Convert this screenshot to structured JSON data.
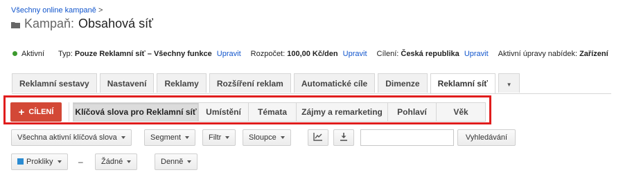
{
  "breadcrumb": {
    "link": "Všechny online kampaně",
    "separator": ">"
  },
  "title": {
    "prefix": "Kampaň:",
    "name": "Obsahová síť",
    "icon": "folder-icon"
  },
  "info": {
    "status": "Aktivní",
    "status_color": "#3c9a2e",
    "type_label": "Typ:",
    "type_value": "Pouze Reklamní síť – Všechny funkce",
    "budget_label": "Rozpočet:",
    "budget_value": "100,00 Kč/den",
    "target_label": "Cílení:",
    "target_value": "Česká republika",
    "edit_link": "Upravit",
    "bid_label": "Aktivní úpravy nabídek:",
    "bid_value": "Zařízení"
  },
  "tabs": [
    {
      "label": "Reklamní sestavy"
    },
    {
      "label": "Nastavení"
    },
    {
      "label": "Reklamy"
    },
    {
      "label": "Rozšíření reklam"
    },
    {
      "label": "Automatické cíle"
    },
    {
      "label": "Dimenze"
    },
    {
      "label": "Reklamní síť",
      "active": true
    }
  ],
  "targeting": {
    "add_button": "CÍLENÍ",
    "add_button_color": "#d34836",
    "highlight_color": "#e01d1d",
    "subtabs": [
      {
        "label": "Klíčová slova pro Reklamní síť",
        "active": true
      },
      {
        "label": "Umístění"
      },
      {
        "label": "Témata"
      },
      {
        "label": "Zájmy a remarketing"
      },
      {
        "label": "Pohlaví"
      },
      {
        "label": "Věk"
      }
    ]
  },
  "toolbar": {
    "filter_all": "Všechna aktivní klíčová slova",
    "segment": "Segment",
    "filter": "Filtr",
    "columns": "Sloupce",
    "chart_icon": "line-chart-icon",
    "download_icon": "download-icon",
    "search_value": "",
    "search_button": "Vyhledávání"
  },
  "graph_options": {
    "metric": "Prokliky",
    "metric_color": "#2a8bd2",
    "dash": "–",
    "compare": "Žádné",
    "period": "Denně"
  }
}
